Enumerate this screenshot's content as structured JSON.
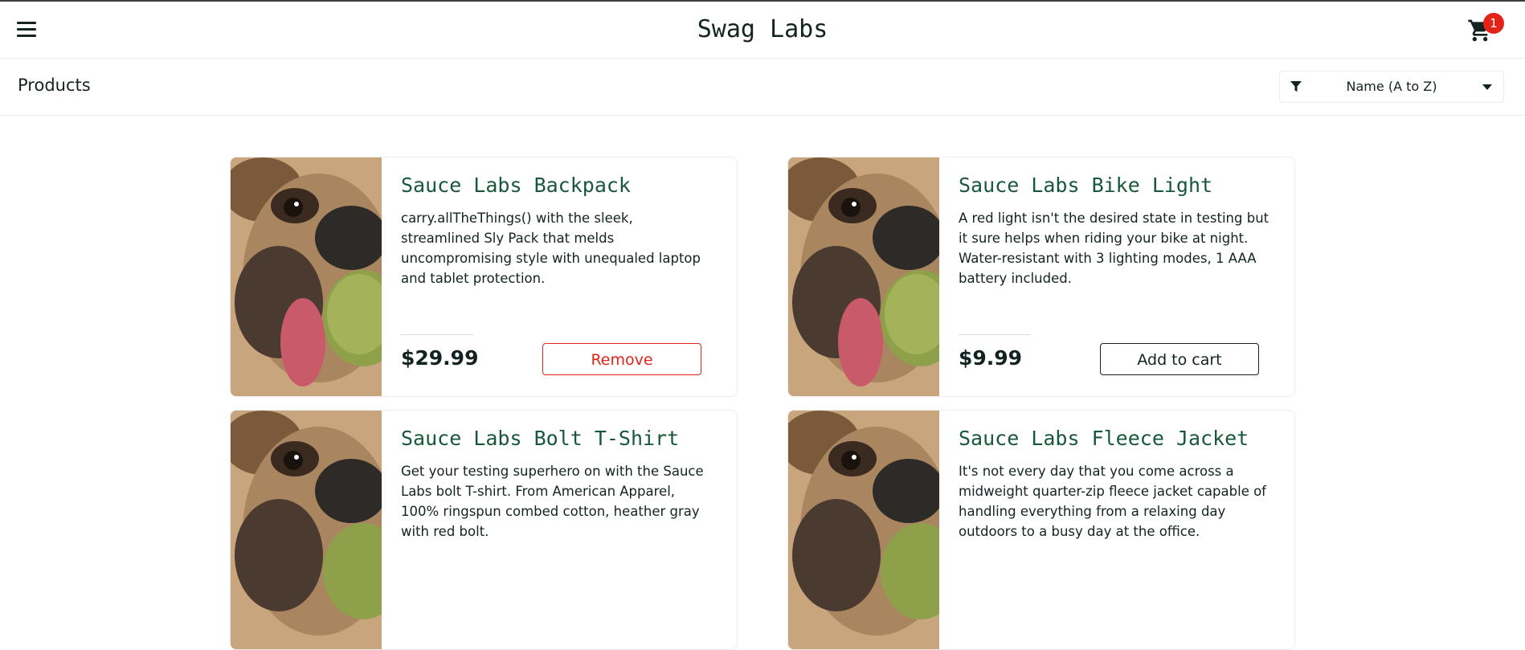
{
  "app": {
    "title": "Swag Labs"
  },
  "header": {
    "menu_icon": "hamburger-menu-icon",
    "cart_icon": "shopping-cart-icon",
    "cart_count": "1"
  },
  "subheader": {
    "title": "Products",
    "sort": {
      "icon": "filter-icon",
      "selected": "Name (A to Z)"
    }
  },
  "colors": {
    "name": "#18583a",
    "remove": "#e2231a",
    "badge": "#e2231a",
    "text": "#132322"
  },
  "products": [
    {
      "name": "Sauce Labs Backpack",
      "description": "carry.allTheThings() with the sleek, streamlined Sly Pack that melds uncompromising style with unequaled laptop and tablet protection.",
      "price": "$29.99",
      "button": "Remove"
    },
    {
      "name": "Sauce Labs Bike Light",
      "description": "A red light isn't the desired state in testing but it sure helps when riding your bike at night. Water-resistant with 3 lighting modes, 1 AAA battery included.",
      "price": "$9.99",
      "button": "Add to cart"
    },
    {
      "name": "Sauce Labs Bolt T-Shirt",
      "description": "Get your testing superhero on with the Sauce Labs bolt T-shirt. From American Apparel, 100% ringspun combed cotton, heather gray with red bolt."
    },
    {
      "name": "Sauce Labs Fleece Jacket",
      "description": "It's not every day that you come across a midweight quarter-zip fleece jacket capable of handling everything from a relaxing day outdoors to a busy day at the office."
    }
  ]
}
